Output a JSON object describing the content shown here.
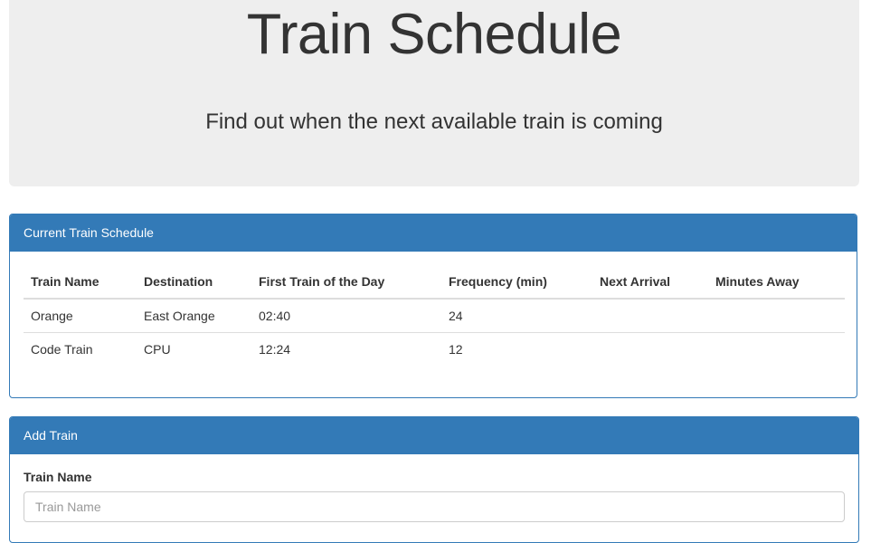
{
  "header": {
    "title": "Train Schedule",
    "subtitle": "Find out when the next available train is coming"
  },
  "schedule": {
    "panel_title": "Current Train Schedule",
    "columns": [
      "Train Name",
      "Destination",
      "First Train of the Day",
      "Frequency (min)",
      "Next Arrival",
      "Minutes Away"
    ],
    "rows": [
      [
        "Orange",
        "East Orange",
        "02:40",
        "24",
        "",
        ""
      ],
      [
        "Code Train",
        "CPU",
        "12:24",
        "12",
        "",
        ""
      ]
    ]
  },
  "add_train": {
    "panel_title": "Add Train",
    "train_name_label": "Train Name",
    "train_name_placeholder": "Train Name",
    "train_name_value": ""
  },
  "colors": {
    "primary": "#337ab7",
    "jumbotron_bg": "#eeeeee"
  }
}
